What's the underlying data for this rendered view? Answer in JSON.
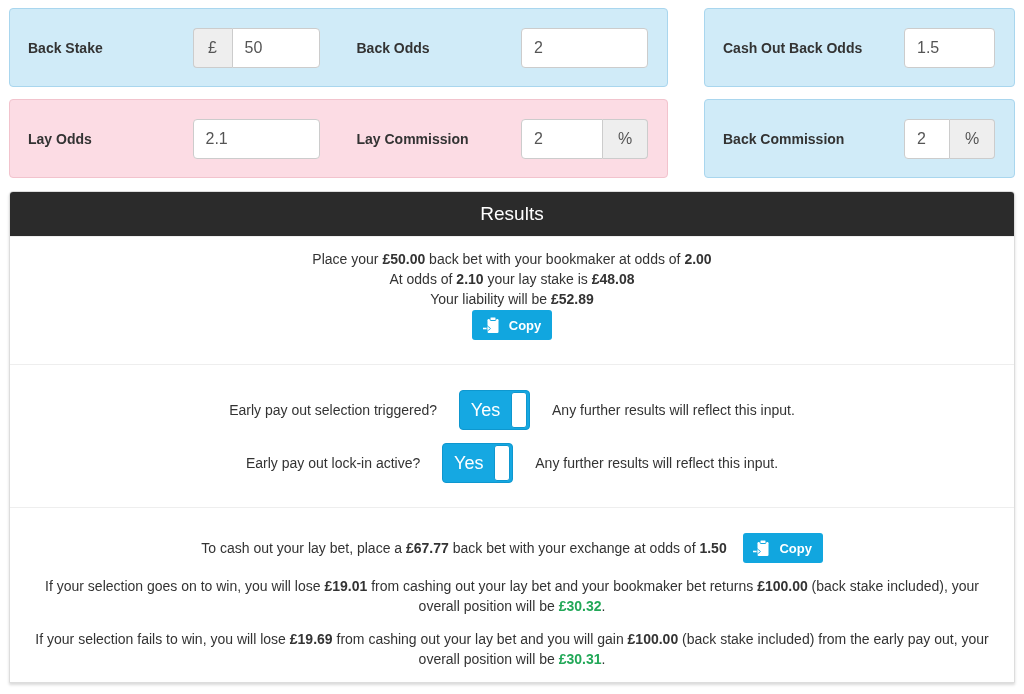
{
  "inputs": {
    "panels": [
      {
        "kind": "back",
        "fields": [
          {
            "label": "Back Stake",
            "prefix": "£",
            "value": "50"
          },
          {
            "label": "Back Odds",
            "value": "2"
          }
        ]
      },
      {
        "kind": "back",
        "fields": [
          {
            "label": "Cash Out Back Odds",
            "value": "1.5"
          }
        ]
      },
      {
        "kind": "lay",
        "fields": [
          {
            "label": "Lay Odds",
            "value": "2.1"
          },
          {
            "label": "Lay Commission",
            "value": "2",
            "suffix": "%"
          }
        ]
      },
      {
        "kind": "back",
        "fields": [
          {
            "label": "Back Commission",
            "value": "2",
            "suffix": "%"
          }
        ]
      }
    ]
  },
  "results": {
    "title": "Results",
    "summary": {
      "lines": [
        "Place your **£50.00** back bet with your bookmaker at odds of **2.00**",
        "At odds of **2.10** your lay stake is **£48.08**",
        "Your liability will be **£52.89**"
      ],
      "copy_button": "Copy"
    },
    "toggles": [
      {
        "label": "Early pay out selection triggered?",
        "on": true,
        "state_label": "Yes",
        "note": "Any further results will reflect this input."
      },
      {
        "label": "Early pay out lock-in active?",
        "on": true,
        "state_label": "Yes",
        "note": "Any further results will reflect this input."
      }
    ],
    "cash_out": {
      "instruction": "To cash out your lay bet, place a **£67.77** back bet with your exchange at odds of **1.50**",
      "copy_button": "Copy",
      "outcomes": [
        {
          "text": "If your selection goes on to win, you will lose **£19.01** from cashing out your lay bet and your bookmaker bet returns **£100.00** (back stake included), your overall position will be ",
          "position": "£30.32",
          "after": ".",
          "profit": true
        },
        {
          "text": "If your selection fails to win, you will lose **£19.69** from cashing out your lay bet and you will gain **£100.00** (back stake included) from the early pay out, your overall position will be ",
          "position": "£30.31",
          "after": ".",
          "profit": true
        }
      ]
    }
  }
}
